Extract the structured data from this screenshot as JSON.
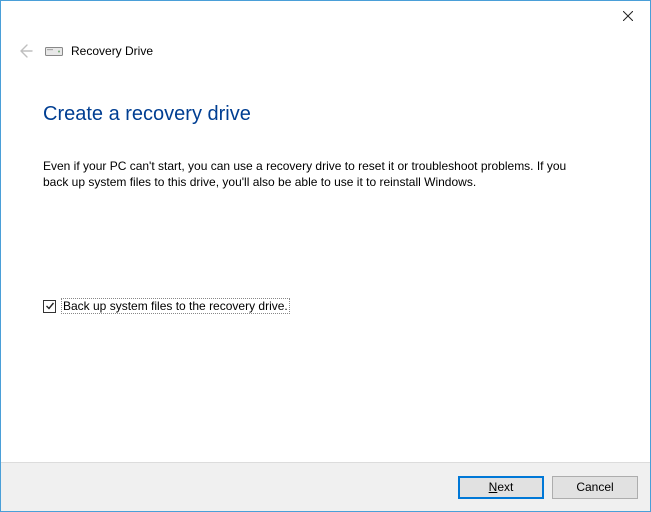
{
  "header": {
    "window_title": "Recovery Drive"
  },
  "main": {
    "heading": "Create a recovery drive",
    "description": "Even if your PC can't start, you can use a recovery drive to reset it or troubleshoot problems. If you back up system files to this drive, you'll also be able to use it to reinstall Windows."
  },
  "checkbox": {
    "checked": true,
    "label": "Back up system files to the recovery drive."
  },
  "footer": {
    "next_underline": "N",
    "next_rest": "ext",
    "cancel": "Cancel"
  }
}
